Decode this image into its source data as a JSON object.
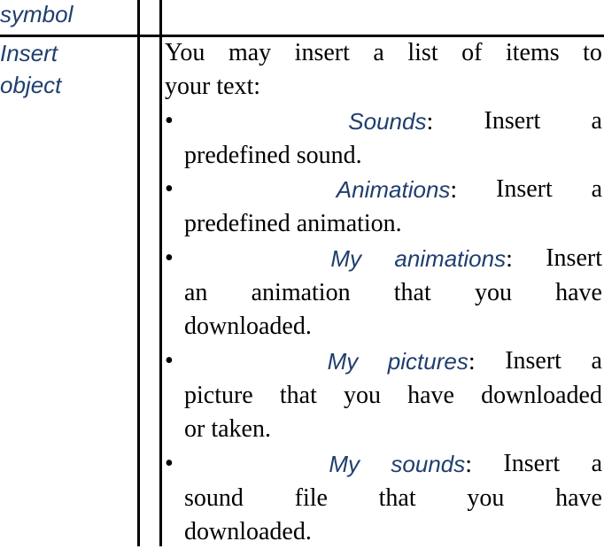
{
  "table": {
    "prev_row_term": "symbol",
    "row": {
      "term_line1": "Insert",
      "term_line2": "object",
      "intro": [
        "You",
        "may",
        "insert",
        "a",
        "list",
        "of",
        "items",
        "to"
      ],
      "intro_line2": "your text:",
      "bullet": "•",
      "items": [
        {
          "keyword": "Sounds",
          "first_line_rest": [
            "Insert",
            "a"
          ],
          "continuation": [
            [
              "predefined sound."
            ]
          ]
        },
        {
          "keyword": "Animations",
          "first_line_rest": [
            "Insert",
            "a"
          ],
          "continuation": [
            [
              "predefined animation."
            ]
          ]
        },
        {
          "keyword": "My animations",
          "first_line_rest": [
            "Insert"
          ],
          "continuation": [
            [
              "an",
              "animation",
              "that",
              "you",
              "have"
            ],
            [
              "downloaded."
            ]
          ]
        },
        {
          "keyword": "My pictures",
          "first_line_rest": [
            "Insert",
            "a"
          ],
          "continuation": [
            [
              "picture",
              "that",
              "you",
              "have",
              "downloaded"
            ],
            [
              "or taken."
            ]
          ]
        },
        {
          "keyword": "My sounds",
          "first_line_rest": [
            "Insert",
            "a"
          ],
          "continuation": [
            [
              "sound",
              "file",
              "that",
              "you",
              "have"
            ],
            [
              "downloaded."
            ]
          ]
        }
      ]
    }
  },
  "colors": {
    "keyword": "#1f3e6e",
    "rule": "#000000",
    "text": "#000000"
  }
}
